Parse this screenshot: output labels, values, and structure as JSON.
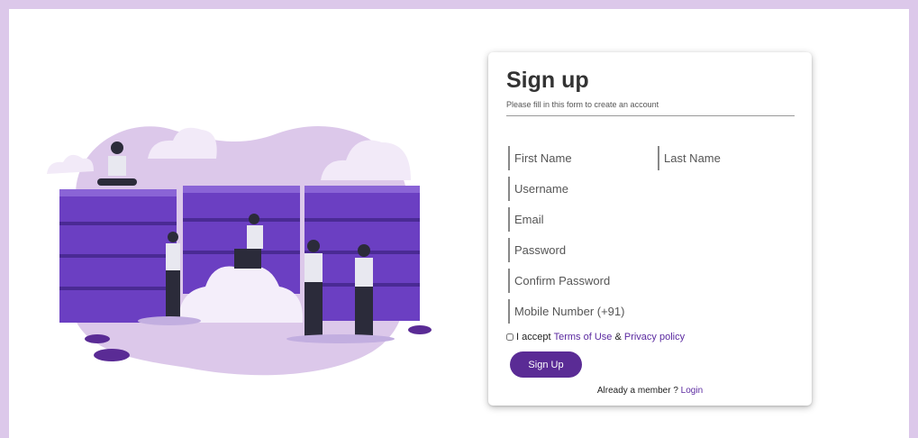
{
  "colors": {
    "frame": "#dcc8ea",
    "accent": "#5a2b95",
    "link": "#5b2aa0",
    "blob": "#dcc8ea",
    "server": "#6b3fc2"
  },
  "illustration": {
    "icon": "server-cloud-illustration"
  },
  "form": {
    "title": "Sign up",
    "subtitle": "Please fill in this form to create an account",
    "first_name_placeholder": "First Name",
    "last_name_placeholder": "Last Name",
    "username_placeholder": "Username",
    "email_placeholder": "Email",
    "password_placeholder": "Password",
    "confirm_password_placeholder": "Confirm Password",
    "mobile_placeholder": "Mobile Number (+91)",
    "terms_prefix": "I accept",
    "terms_link": "Terms of Use",
    "terms_and": "&",
    "privacy_link": "Privacy policy",
    "submit_label": "Sign Up",
    "member_text": "Already a member ?",
    "login_link": "Login"
  }
}
